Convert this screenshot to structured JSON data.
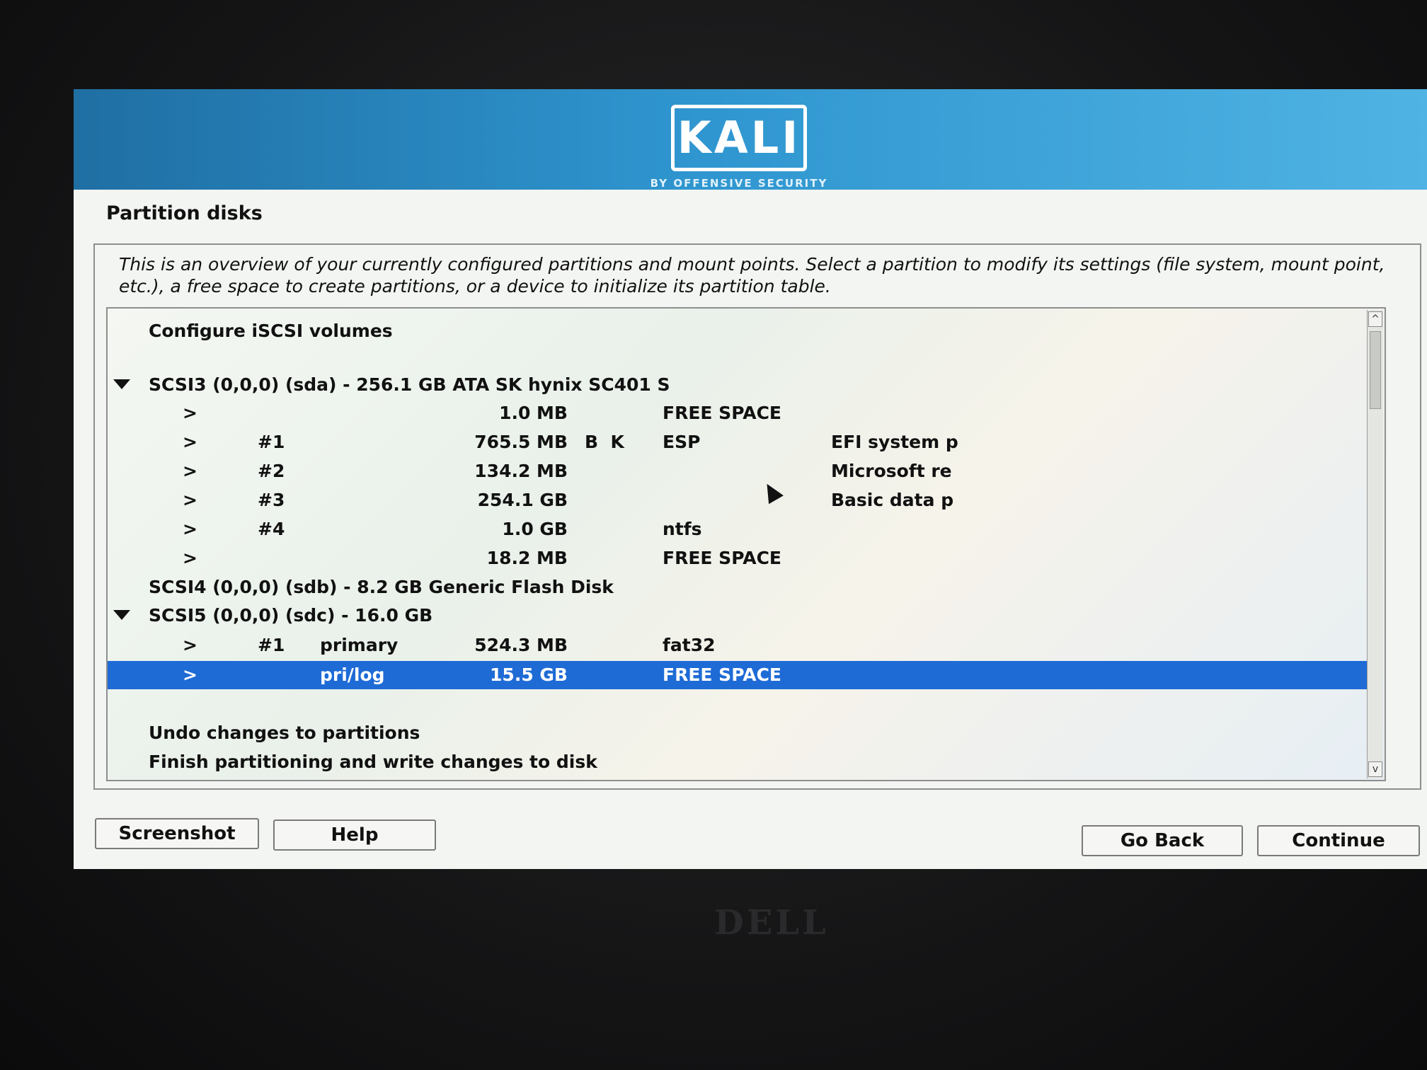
{
  "brand": {
    "logo_text": "KALI",
    "logo_subtitle": "BY OFFENSIVE SECURITY",
    "banner_color": "#2f95cf"
  },
  "page": {
    "title": "Partition disks",
    "description": "This is an overview of your currently configured partitions and mount points. Select a partition to modify its settings (file system, mount point, etc.), a free space to create partitions, or a device to initialize its partition table."
  },
  "list": {
    "configure_iscsi": "Configure iSCSI volumes",
    "disk1": {
      "label": "SCSI3 (0,0,0) (sda) - 256.1 GB ATA SK hynix SC401 S",
      "partitions": [
        {
          "arrow": ">",
          "num": "",
          "type": "",
          "size": "1.0 MB",
          "flags": "",
          "fs": "FREE SPACE",
          "name": ""
        },
        {
          "arrow": ">",
          "num": "#1",
          "type": "",
          "size": "765.5 MB",
          "flags": "B  K",
          "fs": "ESP",
          "name": "EFI system p"
        },
        {
          "arrow": ">",
          "num": "#2",
          "type": "",
          "size": "134.2 MB",
          "flags": "",
          "fs": "",
          "name": "Microsoft re"
        },
        {
          "arrow": ">",
          "num": "#3",
          "type": "",
          "size": "254.1 GB",
          "flags": "",
          "fs": "",
          "name": "Basic data p"
        },
        {
          "arrow": ">",
          "num": "#4",
          "type": "",
          "size": "1.0 GB",
          "flags": "",
          "fs": "ntfs",
          "name": ""
        },
        {
          "arrow": ">",
          "num": "",
          "type": "",
          "size": "18.2 MB",
          "flags": "",
          "fs": "FREE SPACE",
          "name": ""
        }
      ]
    },
    "disk2": {
      "label": "SCSI4 (0,0,0) (sdb) - 8.2 GB Generic Flash Disk"
    },
    "disk3": {
      "label": "SCSI5 (0,0,0) (sdc) - 16.0 GB",
      "partitions": [
        {
          "arrow": ">",
          "num": "#1",
          "type": "primary",
          "size": "524.3 MB",
          "flags": "",
          "fs": "fat32",
          "name": ""
        },
        {
          "arrow": ">",
          "num": "",
          "type": "pri/log",
          "size": "15.5 GB",
          "flags": "",
          "fs": "FREE SPACE",
          "name": ""
        }
      ]
    },
    "undo": "Undo changes to partitions",
    "finish": "Finish partitioning and write changes to disk",
    "selected_color": "#1e6bd6"
  },
  "scrollbar": {
    "up_icon": "chevron-up-icon",
    "down_icon": "chevron-down-icon",
    "up_glyph": "^",
    "down_glyph": "v"
  },
  "buttons": {
    "screenshot": "Screenshot",
    "help": "Help",
    "go_back": "Go Back",
    "continue": "Continue"
  },
  "hardware": {
    "laptop_brand": "DELL"
  }
}
